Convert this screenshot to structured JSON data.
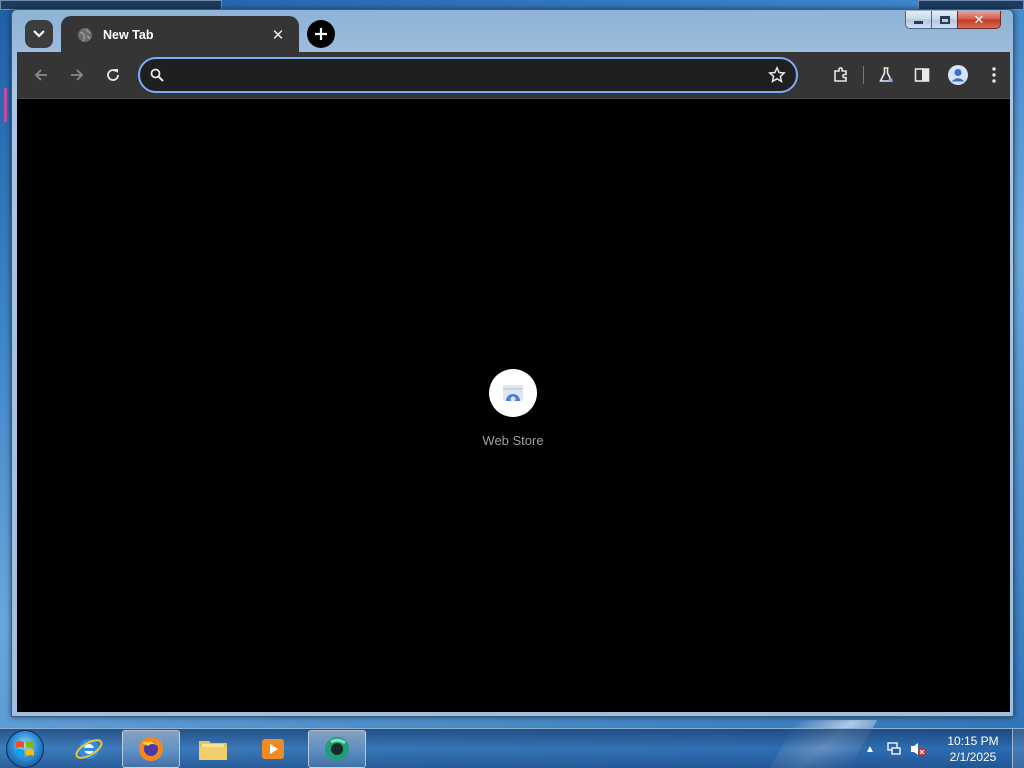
{
  "browser": {
    "tab": {
      "title": "New Tab"
    },
    "omnibox": {
      "value": "",
      "placeholder": ""
    },
    "toolbar_icons": [
      "back-icon",
      "forward-icon",
      "reload-icon",
      "search-icon",
      "star-icon",
      "extensions-icon",
      "labs-icon",
      "side-panel-icon",
      "profile-icon",
      "menu-icon"
    ],
    "accent_color": "#7cacf8"
  },
  "new_tab_page": {
    "shortcuts": [
      {
        "label": "Web Store",
        "icon": "web-store-icon"
      }
    ]
  },
  "taskbar": {
    "pinned": [
      {
        "name": "internet-explorer-icon",
        "running": false
      },
      {
        "name": "firefox-icon",
        "running": true
      },
      {
        "name": "file-explorer-icon",
        "running": false
      },
      {
        "name": "media-player-icon",
        "running": false
      },
      {
        "name": "chrome-icon",
        "running": true
      }
    ],
    "clock": {
      "time": "10:15 PM",
      "date": "2/1/2025"
    }
  }
}
